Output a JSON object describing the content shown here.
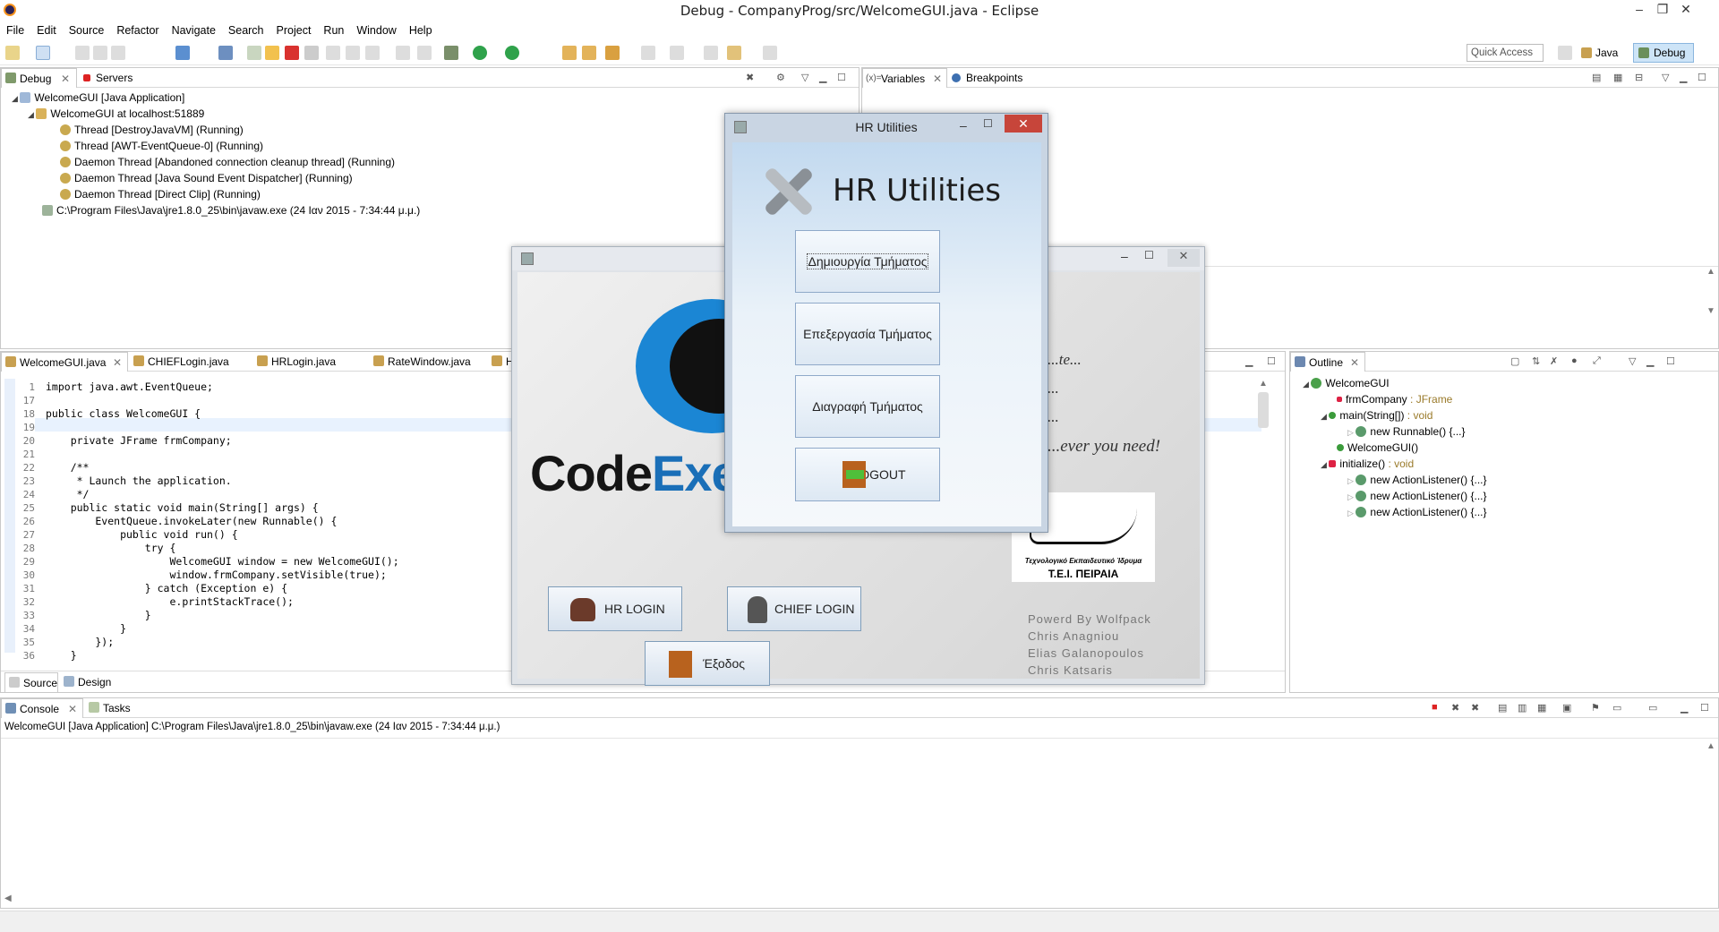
{
  "window": {
    "title": "Debug - CompanyProg/src/WelcomeGUI.java - Eclipse",
    "min": "–",
    "max": "❐",
    "close": "✕"
  },
  "menu": [
    "File",
    "Edit",
    "Source",
    "Refactor",
    "Navigate",
    "Search",
    "Project",
    "Run",
    "Window",
    "Help"
  ],
  "toolbar": {
    "quick_access": "Quick Access",
    "perspectives": [
      "Java",
      "Debug"
    ]
  },
  "debug_view": {
    "tabs": [
      "Debug",
      "Servers"
    ],
    "tree": [
      "WelcomeGUI [Java Application]",
      "WelcomeGUI at localhost:51889",
      "Thread [DestroyJavaVM] (Running)",
      "Thread [AWT-EventQueue-0] (Running)",
      "Daemon Thread [Abandoned connection cleanup thread] (Running)",
      "Daemon Thread [Java Sound Event Dispatcher] (Running)",
      "Daemon Thread [Direct Clip] (Running)",
      "C:\\Program Files\\Java\\jre1.8.0_25\\bin\\javaw.exe (24 Ιαν 2015 - 7:34:44 μ.μ.)"
    ]
  },
  "variables_view": {
    "tabs": [
      "Variables",
      "Breakpoints"
    ]
  },
  "editor": {
    "tabs": [
      "WelcomeGUI.java",
      "CHIEFLogin.java",
      "HRLogin.java",
      "RateWindow.java",
      "H"
    ],
    "bottom_tabs": [
      "Source",
      "Design"
    ],
    "lines": [
      {
        "n": "1",
        "t": "import java.awt.EventQueue;"
      },
      {
        "n": "17",
        "t": ""
      },
      {
        "n": "18",
        "t": "public class WelcomeGUI {"
      },
      {
        "n": "19",
        "t": ""
      },
      {
        "n": "20",
        "t": "    private JFrame frmCompany;"
      },
      {
        "n": "21",
        "t": ""
      },
      {
        "n": "22",
        "t": "    /**"
      },
      {
        "n": "23",
        "t": "     * Launch the application."
      },
      {
        "n": "24",
        "t": "     */"
      },
      {
        "n": "25",
        "t": "    public static void main(String[] args) {"
      },
      {
        "n": "26",
        "t": "        EventQueue.invokeLater(new Runnable() {"
      },
      {
        "n": "27",
        "t": "            public void run() {"
      },
      {
        "n": "28",
        "t": "                try {"
      },
      {
        "n": "29",
        "t": "                    WelcomeGUI window = new WelcomeGUI();"
      },
      {
        "n": "30",
        "t": "                    window.frmCompany.setVisible(true);"
      },
      {
        "n": "31",
        "t": "                } catch (Exception e) {"
      },
      {
        "n": "32",
        "t": "                    e.printStackTrace();"
      },
      {
        "n": "33",
        "t": "                }"
      },
      {
        "n": "34",
        "t": "            }"
      },
      {
        "n": "35",
        "t": "        });"
      },
      {
        "n": "36",
        "t": "    }"
      }
    ]
  },
  "outline": {
    "tab": "Outline",
    "items": [
      {
        "label": "WelcomeGUI",
        "type": ""
      },
      {
        "label": "frmCompany",
        "type": " : JFrame"
      },
      {
        "label": "main(String[])",
        "type": " : void"
      },
      {
        "label": "new Runnable() {...}",
        "type": ""
      },
      {
        "label": "WelcomeGUI()",
        "type": ""
      },
      {
        "label": "initialize()",
        "type": " : void"
      },
      {
        "label": "new ActionListener() {...}",
        "type": ""
      },
      {
        "label": "new ActionListener() {...}",
        "type": ""
      },
      {
        "label": "new ActionListener() {...}",
        "type": ""
      }
    ]
  },
  "console": {
    "tabs": [
      "Console",
      "Tasks"
    ],
    "header": "WelcomeGUI [Java Application] C:\\Program Files\\Java\\jre1.8.0_25\\bin\\javaw.exe (24 Ιαν 2015 - 7:34:44 μ.μ.)"
  },
  "welcome_app": {
    "logo_text_a": "Code",
    "logo_text_b": "Exe",
    "slogan": [
      "...te...",
      "...",
      "...",
      "...ever you need!"
    ],
    "hr_login": "HR LOGIN",
    "chief_login": "CHIEF LOGIN",
    "exit": "Έξοδος",
    "school_line1": "Τεχνολογικό Εκπαιδευτικό Ίδρυμα",
    "school_line2": "Τ.Ε.Ι. ΠΕΙΡΑΙΑ",
    "credits": [
      "Powerd By Wolfpack",
      "Chris Anagniou",
      "Elias Galanopoulos",
      "Chris Katsaris"
    ]
  },
  "hr_dialog": {
    "title": "HR Utilities",
    "header": "HR Utilities",
    "buttons": [
      "Δημιουργία Τμήματος",
      "Επεξεργασία Τμήματος",
      "Διαγραφή Τμήματος",
      "LOGOUT"
    ]
  }
}
